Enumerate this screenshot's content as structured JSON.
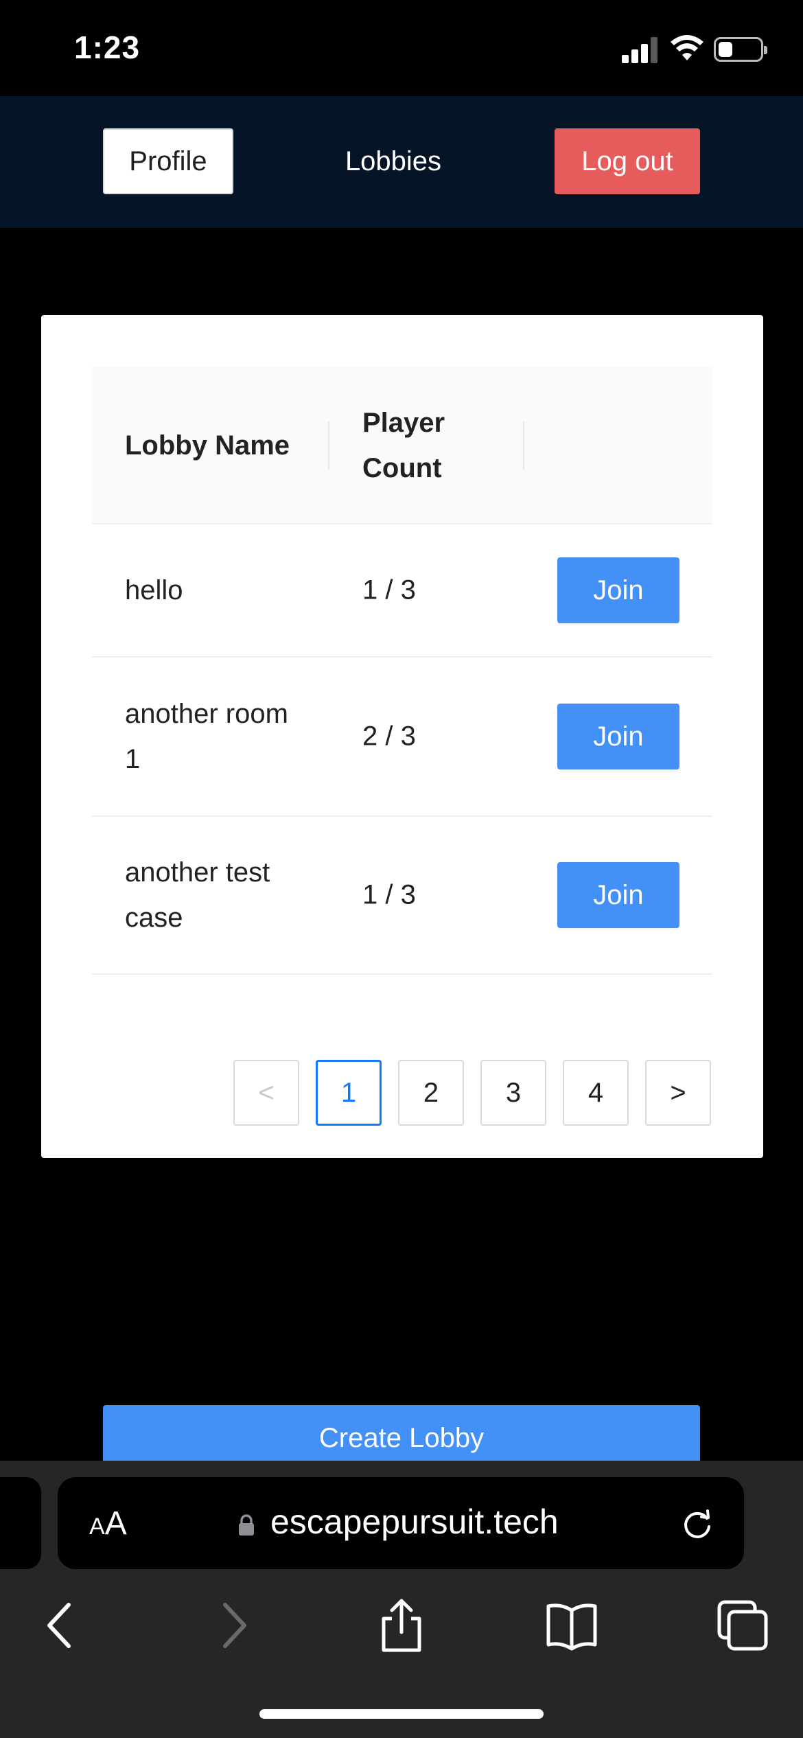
{
  "status_bar": {
    "time": "1:23",
    "battery_level": 0.35
  },
  "nav": {
    "profile_label": "Profile",
    "lobbies_label": "Lobbies",
    "logout_label": "Log out"
  },
  "table": {
    "headers": {
      "name": "Lobby Name",
      "count": "Player Count"
    },
    "rows": [
      {
        "name": "hello",
        "count": "1 / 3",
        "action": "Join"
      },
      {
        "name": "another room 1",
        "count": "2 / 3",
        "action": "Join"
      },
      {
        "name": "another test case",
        "count": "1 / 3",
        "action": "Join"
      }
    ]
  },
  "pagination": {
    "prev": "<",
    "pages": [
      "1",
      "2",
      "3",
      "4"
    ],
    "current": "1",
    "next": ">"
  },
  "create_label": "Create Lobby",
  "browser": {
    "aa_small": "A",
    "aa_large": "A",
    "url": "escapepursuit.tech"
  },
  "colors": {
    "nav_bg": "#051427",
    "primary": "#4390f6",
    "danger": "#e65b5b",
    "active_page": "#1677ff"
  },
  "icons": [
    "lock-icon",
    "reload-icon",
    "back-icon",
    "forward-icon",
    "share-icon",
    "bookmarks-icon",
    "tabs-icon",
    "wifi-icon",
    "signal-icon",
    "battery-icon"
  ]
}
